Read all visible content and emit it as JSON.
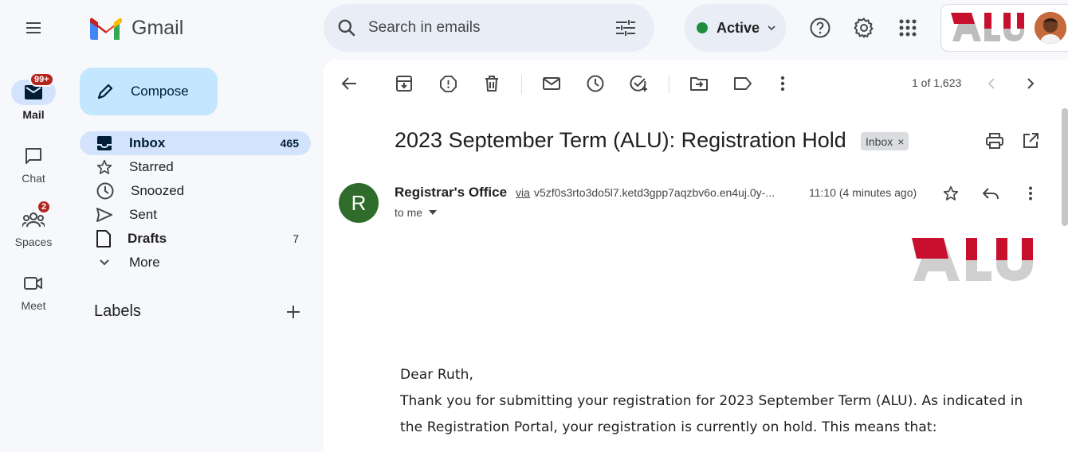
{
  "app": {
    "name": "Gmail"
  },
  "rail": [
    {
      "label": "Mail",
      "badge": "99+"
    },
    {
      "label": "Chat",
      "badge": ""
    },
    {
      "label": "Spaces",
      "badge": "2"
    },
    {
      "label": "Meet",
      "badge": ""
    }
  ],
  "compose": {
    "label": "Compose"
  },
  "nav": [
    {
      "label": "Inbox",
      "count": "465"
    },
    {
      "label": "Starred",
      "count": ""
    },
    {
      "label": "Snoozed",
      "count": ""
    },
    {
      "label": "Sent",
      "count": ""
    },
    {
      "label": "Drafts",
      "count": "7"
    },
    {
      "label": "More",
      "count": ""
    }
  ],
  "labels": {
    "title": "Labels"
  },
  "search": {
    "placeholder": "Search in emails"
  },
  "status": {
    "label": "Active"
  },
  "account": {
    "logo_text": "ALU"
  },
  "toolbar": {
    "pager": "1 of 1,623"
  },
  "email": {
    "subject": "2023 September Term (ALU): Registration Hold",
    "label_chip": "Inbox",
    "chip_close": "×",
    "sender_initial": "R",
    "sender": "Registrar's Office",
    "via": "via",
    "address": "v5zf0s3rto3do5l7.ketd3gpp7aqzbv6o.en4uj.0y-...",
    "time": "11:10 (4 minutes ago)",
    "to": "to me",
    "logo_text": "ALU",
    "body": [
      "Dear Ruth,",
      "Thank you for submitting your registration for 2023 September Term (ALU). As indicated in",
      "the Registration Portal, your registration is currently on hold. This means that:"
    ]
  },
  "colors": {
    "accent": "#d3e3fd",
    "compose": "#c2e7ff",
    "badge": "#b3261e",
    "alu_red": "#c8102e",
    "online": "#1e8e3e"
  }
}
